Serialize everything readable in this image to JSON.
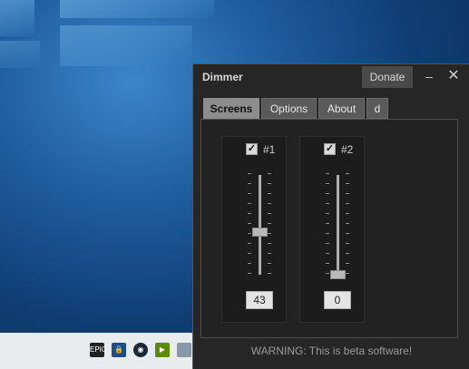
{
  "window": {
    "title": "Dimmer",
    "donate_label": "Donate",
    "minimize_glyph": "–",
    "close_glyph": "✕"
  },
  "tabs": [
    {
      "label": "Screens",
      "active": true
    },
    {
      "label": "Options",
      "active": false
    },
    {
      "label": "About",
      "active": false
    },
    {
      "label": "d",
      "active": false
    }
  ],
  "screens": [
    {
      "label": "#1",
      "checked": true,
      "value": "43",
      "slider_level": 0.43
    },
    {
      "label": "#2",
      "checked": true,
      "value": "0",
      "slider_level": 0.0
    }
  ],
  "warning": "WARNING: This is beta software!",
  "colors": {
    "window_bg": "#262626",
    "active_tab": "#8d8d8d",
    "desktop_blue": "#1f5d9e"
  },
  "tray_icons": [
    "epic-games-icon",
    "lock-icon",
    "steam-icon",
    "nvidia-icon",
    "display-icon"
  ],
  "tray_icon_text": {
    "epic": "EPIC"
  }
}
